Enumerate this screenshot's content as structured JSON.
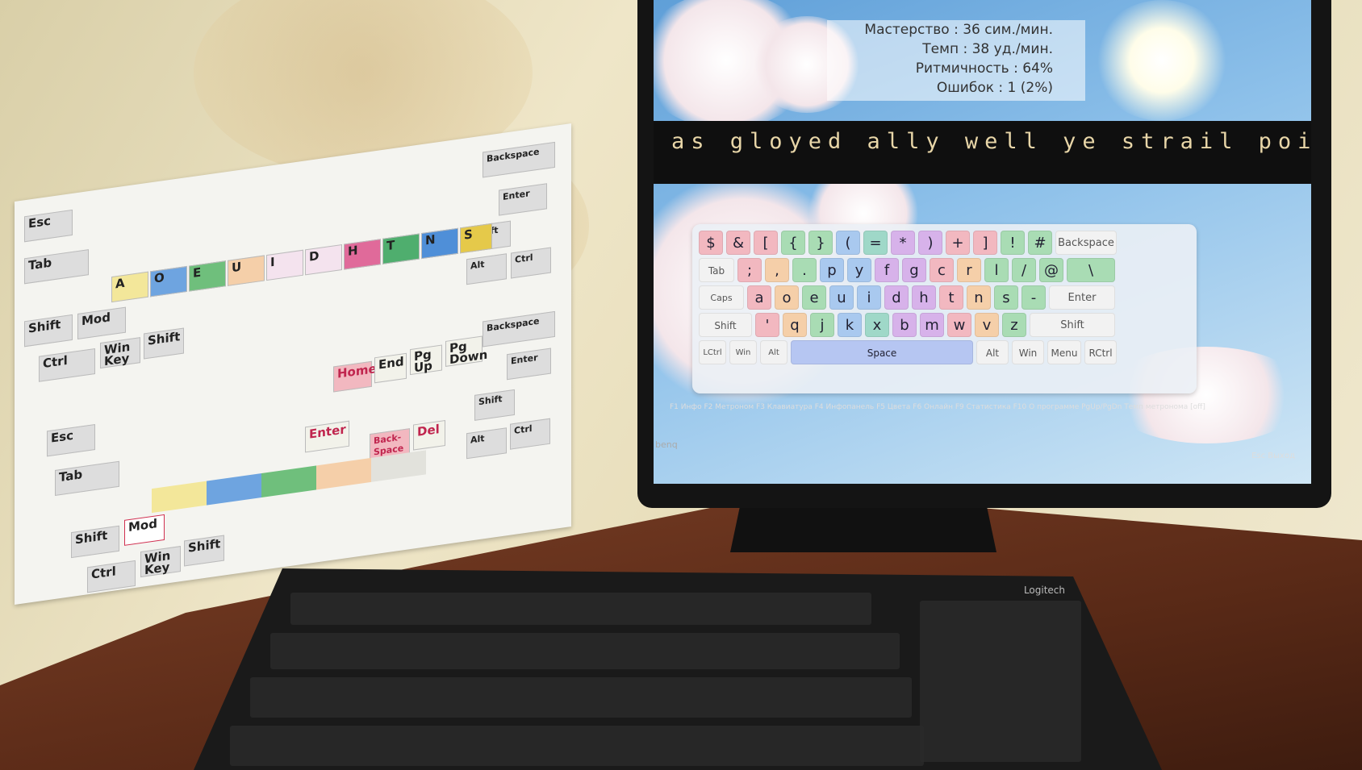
{
  "monitor": {
    "brand": "benq",
    "stats": [
      {
        "label": "Мастерство : 36 сим./мин."
      },
      {
        "label": "Темп : 38 уд./мин."
      },
      {
        "label": "Ритмичность : 64%"
      },
      {
        "label": "Ошибок : 1 (2%)"
      }
    ],
    "typing_text": "as gloyed ally well ye strail pointo",
    "virtual_keyboard": {
      "row1": [
        "$",
        "&",
        "[",
        "{",
        "}",
        "(",
        "=",
        "*",
        ")",
        "+",
        "]",
        "!",
        "#",
        "Backspace"
      ],
      "row2": [
        "Tab",
        ";",
        ",",
        ".",
        "p",
        "y",
        "f",
        "g",
        "c",
        "r",
        "l",
        "/",
        "@",
        "\\"
      ],
      "row3": [
        "Caps Lock",
        "a",
        "o",
        "e",
        "u",
        "i",
        "d",
        "h",
        "t",
        "n",
        "s",
        "-",
        "Enter"
      ],
      "row4": [
        "Shift",
        "'",
        "q",
        "j",
        "k",
        "x",
        "b",
        "m",
        "w",
        "v",
        "z",
        "Shift"
      ],
      "row5": [
        "LCtrl",
        "Win",
        "Alt",
        "Space",
        "Alt",
        "Win",
        "Menu",
        "RCtrl"
      ]
    },
    "function_bar": "F1 Инфо F2 Метроном F3 Клавиатура F4 Инфопанель F5 Цвета F6 Онлайн F9 Статистика F10 О программе PgUp/PgDn Темп метронома [off]",
    "esc_label": "Esc Выход"
  },
  "paper_chart": {
    "top_labels": [
      "Esc",
      "Tab",
      "Shift",
      "Mod",
      "Ctrl",
      "Win Key",
      "Shift",
      "Backspace",
      "Enter",
      "Shift",
      "Alt",
      "Ctrl"
    ],
    "home_row": [
      "A",
      "O",
      "E",
      "U",
      "I",
      "D",
      "H",
      "T",
      "N",
      "S"
    ],
    "bottom_labels": [
      "Esc",
      "Tab",
      "Shift",
      "Mod",
      "Ctrl",
      "Win Key",
      "Shift",
      "Home",
      "End",
      "Pg Up",
      "Pg Down",
      "Enter",
      "Back-Space",
      "Del",
      "Backspace",
      "Enter",
      "Shift",
      "Alt",
      "Ctrl"
    ]
  },
  "physical_keyboard": {
    "brand": "Logitech"
  },
  "colors": {
    "key_red": "#f2b8c0",
    "key_orange": "#f5cfa9",
    "key_yellow": "#f3e79a",
    "key_green": "#a9dcb4",
    "key_teal": "#9fd8c8",
    "key_blue": "#a9c9ef",
    "key_purple": "#d7b2ea",
    "space_blue": "#b6c6f2"
  }
}
